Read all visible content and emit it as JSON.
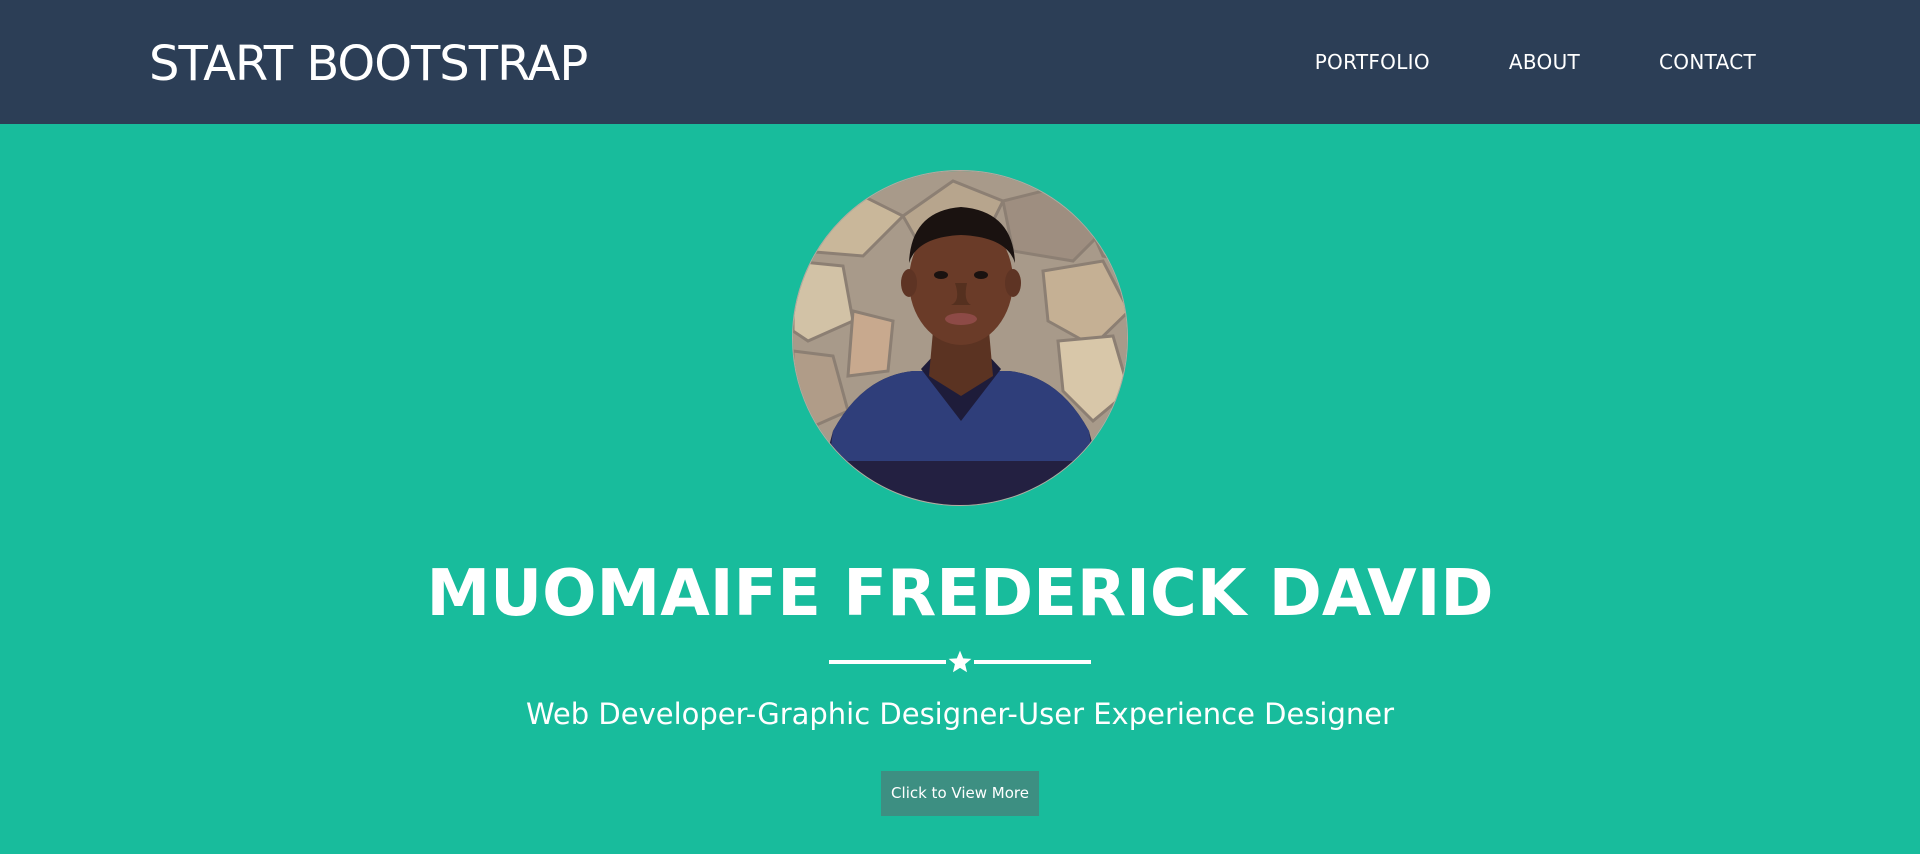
{
  "navbar": {
    "brand": "START BOOTSTRAP",
    "links": [
      {
        "label": "PORTFOLIO"
      },
      {
        "label": "ABOUT"
      },
      {
        "label": "CONTACT"
      }
    ]
  },
  "hero": {
    "name": "MUOMAIFE FREDERICK DAVID",
    "tagline": "Web Developer-Graphic Designer-User Experience Designer",
    "button_label": "Click to View More",
    "divider_icon": "star-icon"
  },
  "colors": {
    "navbar_bg": "#2c3e56",
    "hero_bg": "#18bc9c",
    "button_bg": "#3d8f82",
    "text": "#ffffff"
  }
}
